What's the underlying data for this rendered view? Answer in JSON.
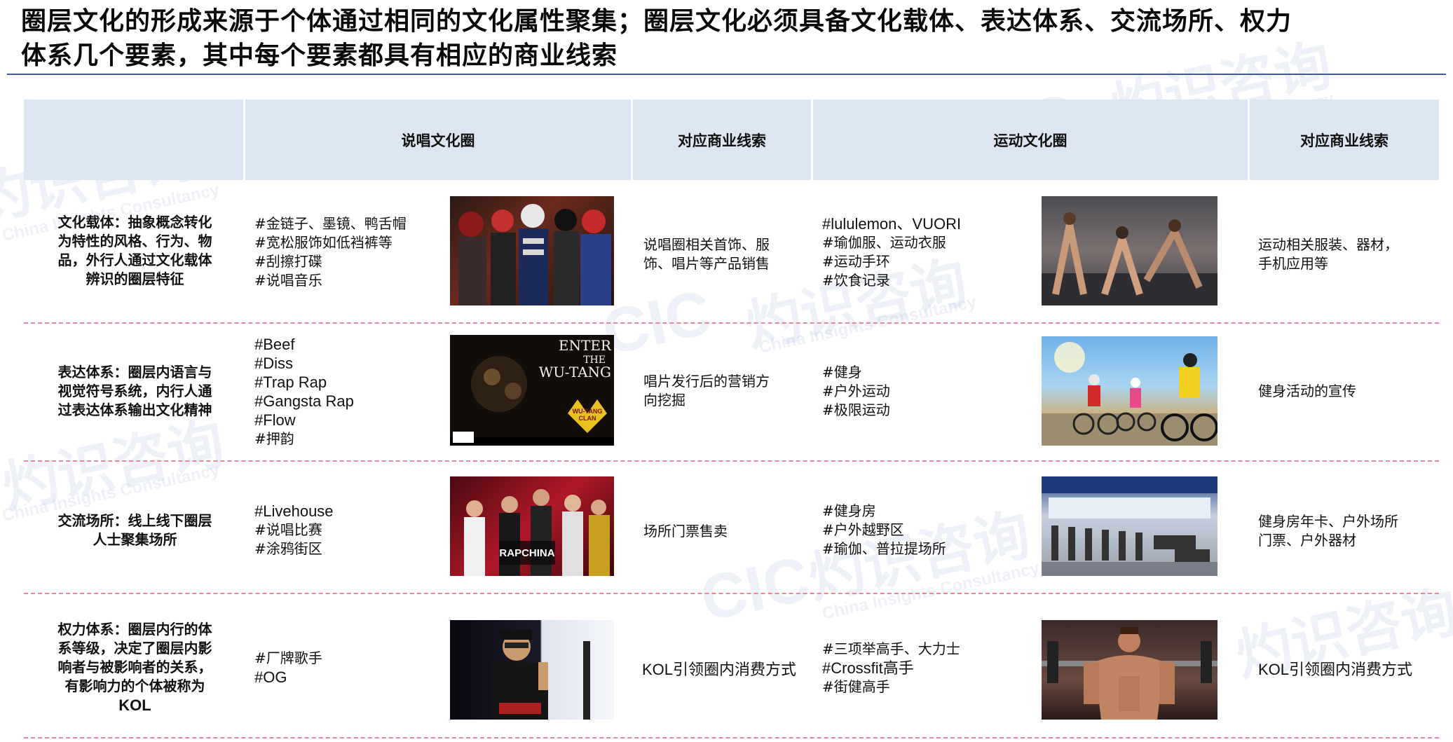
{
  "title": {
    "line1": "圈层文化的形成来源于个体通过相同的文化属性聚集；圈层文化必须具备文化载体、表达体系、交流场所、权力",
    "line2": "体系几个要素，其中每个要素都具有相应的商业线索"
  },
  "headers": {
    "rap": "说唱文化圈",
    "rap_business": "对应商业线索",
    "sports": "运动文化圈",
    "sports_business": "对应商业线索"
  },
  "rows": [
    {
      "label": [
        "文化载体：抽象概念转化",
        "为特性的风格、行为、物",
        "品，外行人通过文化载体",
        "辨识的圈层特征"
      ],
      "rap_tags": [
        "#金链子、墨镜、鸭舌帽",
        "#宽松服饰如低裆裤等",
        "#刮擦打碟",
        "#说唱音乐"
      ],
      "rap_business": [
        "说唱圈相关首饰、服",
        "饰、唱片等产品销售"
      ],
      "sports_tags": [
        "#lululemon、VUORI",
        "#瑜伽服、运动衣服",
        "#运动手环",
        "#饮食记录"
      ],
      "sports_business": [
        "运动相关服装、器材，",
        "手机应用等"
      ]
    },
    {
      "label": [
        "表达体系：圈层内语言与",
        "视觉符号系统，内行人通",
        "过表达体系输出文化精神"
      ],
      "rap_tags": [
        "#Beef",
        "#Diss",
        "#Trap Rap",
        "#Gangsta Rap",
        "#Flow",
        "#押韵"
      ],
      "rap_business": [
        "唱片发行后的营销方",
        "向挖掘"
      ],
      "sports_tags": [
        "#健身",
        "#户外运动",
        "#极限运动"
      ],
      "sports_business": [
        "健身活动的宣传"
      ]
    },
    {
      "label": [
        "交流场所：线上线下圈层",
        "人士聚集场所"
      ],
      "rap_tags": [
        "#Livehouse",
        "#说唱比赛",
        "#涂鸦街区"
      ],
      "rap_business": [
        "场所门票售卖"
      ],
      "sports_tags": [
        "#健身房",
        "#户外越野区",
        "#瑜伽、普拉提场所"
      ],
      "sports_business": [
        "健身房年卡、户外场所",
        "门票、户外器材"
      ]
    },
    {
      "label": [
        "权力体系：圈层内行的体",
        "系等级，决定了圈层内影",
        "响者与被影响者的关系，",
        "有影响力的个体被称为"
      ],
      "label_kol": "KOL",
      "rap_tags": [
        "#厂牌歌手",
        "#OG"
      ],
      "rap_business": [
        "KOL引领圈内消费方式"
      ],
      "sports_tags": [
        "#三项举高手、大力士",
        "#Crossfit高手",
        "#街健高手"
      ],
      "sports_business": [
        "KOL引领圈内消费方式"
      ]
    }
  ],
  "images": {
    "album_cover_text": [
      "ENTER",
      "THE",
      "WU-TANG"
    ],
    "album_logo_text": [
      "WU-TANG",
      "CLAN"
    ],
    "show_banner": "RAPCHINA"
  },
  "watermark": {
    "cn": "灼识咨询",
    "logo": "CIC",
    "en": "China Insights Consultancy"
  },
  "colors": {
    "header_bg": "#dce6f2",
    "title_rule": "#3a5aa8",
    "divider": "#e8869c"
  }
}
